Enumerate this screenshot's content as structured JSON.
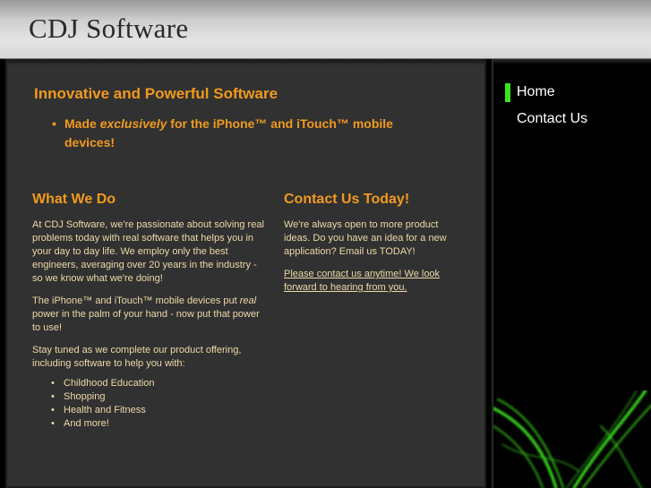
{
  "header": {
    "site_title": "CDJ Software"
  },
  "hero": {
    "title": "Innovative and Powerful Software",
    "bullet_pre": "Made ",
    "bullet_em": "exclusively",
    "bullet_post": " for the iPhone™ and iTouch™ mobile devices!"
  },
  "what_we_do": {
    "heading": "What We Do",
    "p1": "At CDJ Software, we're passionate about solving real problems today with real software that helps you in your day to day life. We employ only the best engineers, averaging over 20 years in the industry - so we know what we're doing!",
    "p2_pre": "The iPhone™ and iTouch™ mobile devices put ",
    "p2_em": "real",
    "p2_post": " power in the palm of your hand - now put that power to use!",
    "p3": "Stay tuned as we complete our product offering, including software to help you with:",
    "items": [
      "Childhood Education",
      "Shopping",
      "Health and Fitness",
      "And more!"
    ]
  },
  "contact": {
    "heading": "Contact Us Today!",
    "p1": "We're always open to more product ideas. Do you have an idea for a new application? Email us TODAY!",
    "link": "Please contact us anytime! We look forward to hearing from you."
  },
  "nav": {
    "items": [
      "Home",
      "Contact Us"
    ],
    "active": "Home"
  },
  "colors": {
    "accent": "#f29a1c",
    "nav_marker": "#39e21b",
    "panel": "#313131",
    "body_text": "#ecd9a8"
  }
}
